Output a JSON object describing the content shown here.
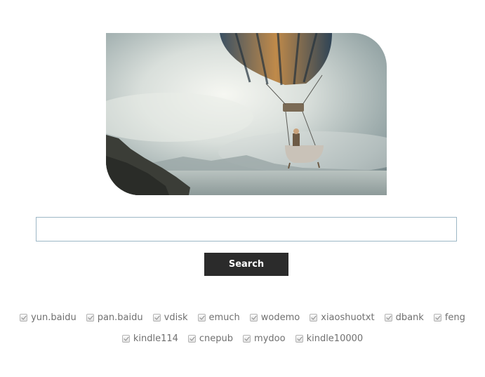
{
  "hero": {
    "image": "hot-air-balloon-with-bathtub-basket-over-misty-lake"
  },
  "search": {
    "input_value": "",
    "placeholder": "",
    "button_label": "Search"
  },
  "sources": {
    "row1": [
      {
        "label": "yun.baidu",
        "checked": true
      },
      {
        "label": "pan.baidu",
        "checked": true
      },
      {
        "label": "vdisk",
        "checked": true
      },
      {
        "label": "emuch",
        "checked": true
      },
      {
        "label": "wodemo",
        "checked": true
      },
      {
        "label": "xiaoshuotxt",
        "checked": true
      },
      {
        "label": "dbank",
        "checked": true
      },
      {
        "label": "feng",
        "checked": true
      }
    ],
    "row2": [
      {
        "label": "kindle114",
        "checked": true
      },
      {
        "label": "cnepub",
        "checked": true
      },
      {
        "label": "mydoo",
        "checked": true
      },
      {
        "label": "kindle10000",
        "checked": true
      }
    ]
  },
  "colors": {
    "button_bg": "#2b2b2b",
    "input_border": "#9db7c6",
    "label_text": "#707070"
  }
}
